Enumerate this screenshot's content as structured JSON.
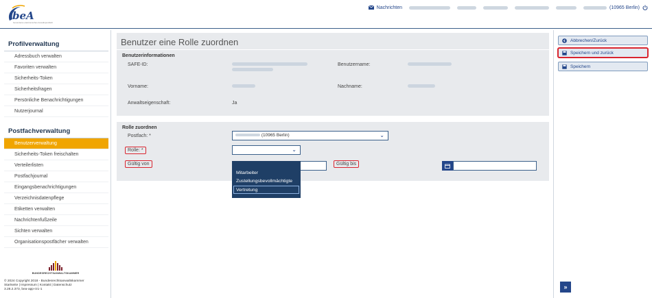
{
  "app": {
    "brand": "beA",
    "tagline": "besonderes elektronisches Anwaltspostfach"
  },
  "topnav": {
    "messages_label": "Nachrichten",
    "user_label": "(10965 Berlin)"
  },
  "sidebar": {
    "profile_title": "Profilverwaltung",
    "profile_items": [
      "Adressbuch verwalten",
      "Favoriten verwalten",
      "Sicherheits-Token",
      "Sicherheitsfragen",
      "Persönliche Benachrichtigungen",
      "Nutzerjournal"
    ],
    "postfach_title": "Postfachverwaltung",
    "postfach_items": [
      "Benutzerverwaltung",
      "Sicherheits-Token freischalten",
      "Verteilerlisten",
      "Postfachjournal",
      "Eingangsbenachrichtigungen",
      "Verzeichnisdatenpflege",
      "Etiketten verwalten",
      "Nachrichtenfußzeile",
      "Sichten verwalten",
      "Organisationspostfächer verwalten"
    ],
    "active_item": "Benutzerverwaltung",
    "kammer_name": "BUNDESRECHTSANWALTSKAMMER",
    "footer_copyright": "© 2024 Copyright 2018 - Bundesrechtsanwaltskammer",
    "footer_links": "Startseite | Impressum | Kontakt | Datenschutz",
    "footer_version": "3.28.2.373, bea-app-rz1-1"
  },
  "main": {
    "page_title": "Benutzer eine Rolle zuordnen",
    "info": {
      "heading": "Benutzerinformationen",
      "safe_id_label": "SAFE-ID:",
      "username_label": "Benutzername:",
      "firstname_label": "Vorname:",
      "lastname_label": "Nachname:",
      "lawyer_label": "Anwaltseigenschaft:",
      "lawyer_value": "Ja"
    },
    "role": {
      "heading": "Rolle zuordnen",
      "postfach_label": "Postfach: *",
      "postfach_value": "(10965 Berlin)",
      "role_label": "Rolle: *",
      "role_value": "",
      "valid_from_label": "Gültig von",
      "valid_to_label": "Gültig bis",
      "options": [
        "Mitarbeiter",
        "Zustellungsbevollmächtigte",
        "Vertretung"
      ],
      "highlighted_option": "Vertretung"
    }
  },
  "rightbar": {
    "back_label": "Abbrechen/Zurück",
    "save_back_label": "Speichern und zurück",
    "save_label": "Speichern"
  },
  "colors": {
    "accent": "#f0a500",
    "brand": "#23468a",
    "highlight_red": "#d9242e",
    "dropdown_bg": "#1f3f66"
  }
}
